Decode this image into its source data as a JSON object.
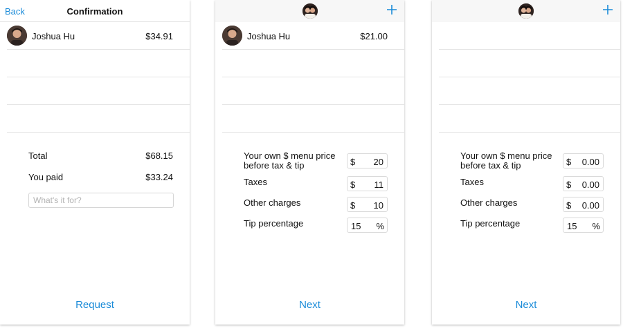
{
  "colors": {
    "accent": "#1a8bd8",
    "separator": "#e4e4e4",
    "navbar_bg": "#f7f7f7"
  },
  "icons": {
    "plus": "plus-icon",
    "avatar": "avatar-photo"
  },
  "screen1": {
    "back_label": "Back",
    "title": "Confirmation",
    "rows": [
      {
        "name": "Joshua Hu",
        "amount": "$34.91"
      }
    ],
    "total_label": "Total",
    "total_value": "$68.15",
    "paid_label": "You paid",
    "paid_value": "$33.24",
    "purpose_placeholder": "What's it for?",
    "purpose_value": "",
    "action_label": "Request"
  },
  "screen2": {
    "rows": [
      {
        "name": "Joshua Hu",
        "amount": "$21.00"
      }
    ],
    "form": [
      {
        "label": "Your own $ menu price\nbefore tax & tip",
        "prefix": "$",
        "value": "20",
        "suffix": ""
      },
      {
        "label": "Taxes",
        "prefix": "$",
        "value": "11",
        "suffix": ""
      },
      {
        "label": "Other charges",
        "prefix": "$",
        "value": "10",
        "suffix": ""
      },
      {
        "label": "Tip percentage",
        "prefix": "",
        "value": "15",
        "suffix": "%"
      }
    ],
    "action_label": "Next"
  },
  "screen3": {
    "rows": [],
    "form": [
      {
        "label": "Your own $ menu price\nbefore tax & tip",
        "prefix": "$",
        "value": "0.00",
        "suffix": ""
      },
      {
        "label": "Taxes",
        "prefix": "$",
        "value": "0.00",
        "suffix": ""
      },
      {
        "label": "Other charges",
        "prefix": "$",
        "value": "0.00",
        "suffix": ""
      },
      {
        "label": "Tip percentage",
        "prefix": "",
        "value": "15",
        "suffix": "%"
      }
    ],
    "action_label": "Next"
  }
}
